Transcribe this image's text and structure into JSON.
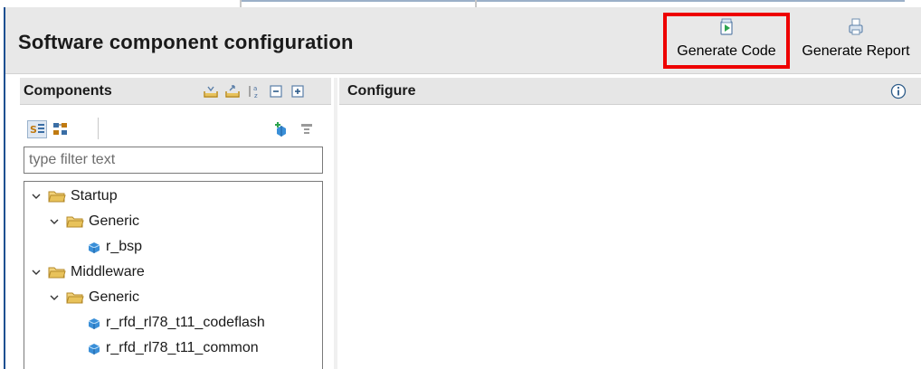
{
  "header": {
    "title": "Software component configuration",
    "generate_code_label": "Generate Code",
    "generate_report_label": "Generate Report"
  },
  "components": {
    "title": "Components",
    "filter_placeholder": "type filter text",
    "tree": [
      {
        "label": "Startup",
        "level": 0,
        "type": "folder",
        "expanded": true
      },
      {
        "label": "Generic",
        "level": 1,
        "type": "folder",
        "expanded": true
      },
      {
        "label": "r_bsp",
        "level": 2,
        "type": "component"
      },
      {
        "label": "Middleware",
        "level": 0,
        "type": "folder",
        "expanded": true
      },
      {
        "label": "Generic",
        "level": 1,
        "type": "folder",
        "expanded": true
      },
      {
        "label": "r_rfd_rl78_t11_codeflash",
        "level": 2,
        "type": "component"
      },
      {
        "label": "r_rfd_rl78_t11_common",
        "level": 2,
        "type": "component"
      }
    ]
  },
  "configure": {
    "title": "Configure"
  },
  "colors": {
    "highlight_border": "#ee0000",
    "header_bg": "#e8e8e8",
    "panel_header_bg": "#e6e6e6",
    "folder_yellow": "#e8c25a",
    "component_blue": "#3a8fd8"
  },
  "icons": {
    "generate_code": "generate-code-icon",
    "generate_report": "generate-report-icon",
    "info": "info-icon"
  }
}
